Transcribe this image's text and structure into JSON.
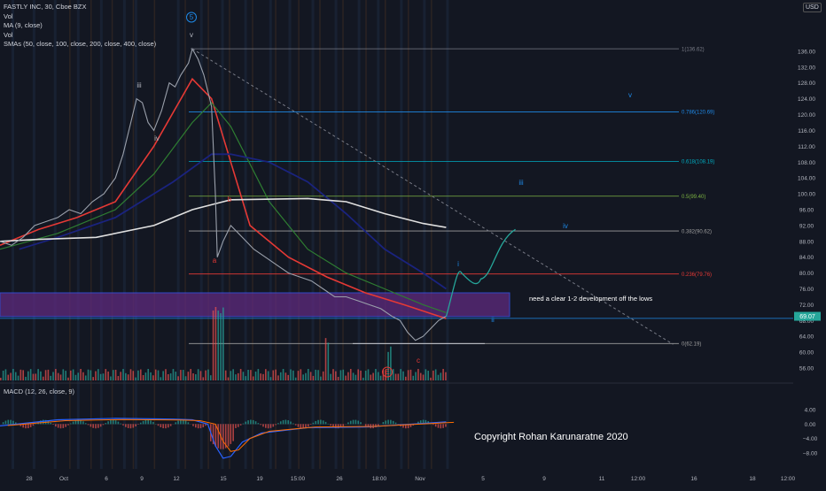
{
  "legend": {
    "title": "FASTLY INC, 30, Cboe BZX",
    "lines": [
      "Vol",
      "MA (9, close)",
      "Vol",
      "SMAs (50, close, 100, close, 200, close, 400, close)"
    ]
  },
  "currency": "USD",
  "macd_label": "MACD (12, 26, close, 9)",
  "copyright": "Copyright Rohan Karunaratne 2020",
  "note": "need a clear 1-2 development off the lows",
  "price_badge": "69.07",
  "colors": {
    "background": "#131722",
    "price": "#9aa0ab",
    "ma_red": "#e53935",
    "ma_green": "#2e7d32",
    "ma_blue": "#1a237e",
    "ma_white": "#e0e0e0",
    "zone": "#5e2a7e",
    "wave_projection": "#26a69a",
    "vol_up": "#26a69a",
    "vol_down": "#ef5350"
  },
  "chart_data": {
    "type": "line",
    "title": "FASTLY INC, 30, Cboe BZX",
    "y_axis": {
      "ticks": [
        136.0,
        132.0,
        128.0,
        124.0,
        120.0,
        116.0,
        112.0,
        108.0,
        104.0,
        100.0,
        96.0,
        92.0,
        88.0,
        84.0,
        80.0,
        76.0,
        72.0,
        68.0,
        64.0,
        60.0,
        56.0
      ],
      "ylim": [
        54,
        140
      ]
    },
    "macd_axis": {
      "ticks": [
        "4.00",
        "0.00",
        "−4.00",
        "−8.00"
      ],
      "ylim": [
        -10,
        6
      ]
    },
    "x_ticks": [
      "28",
      "Oct",
      "6",
      "9",
      "12",
      "15",
      "19",
      "15:00",
      "26",
      "18:00",
      "Nov",
      "5",
      "9",
      "11",
      "12:00",
      "16",
      "18",
      "12:00"
    ],
    "fib_levels": [
      {
        "label": "1(136.62)",
        "value": 136.62
      },
      {
        "label": "0.786(120.69)",
        "value": 120.69
      },
      {
        "label": "0.618(108.19)",
        "value": 108.19
      },
      {
        "label": "0.5(99.40)",
        "value": 99.4
      },
      {
        "label": "0.382(90.62)",
        "value": 90.62
      },
      {
        "label": "0.236(79.76)",
        "value": 79.76
      },
      {
        "label": "0(62.19)",
        "value": 62.19
      }
    ],
    "wave_labels": [
      "5",
      "v",
      "iii",
      "iv",
      "a",
      "b",
      "c",
      "E",
      "i",
      "ii",
      "iii",
      "iv",
      "v"
    ],
    "price_series": {
      "name": "FSLY",
      "points": [
        [
          0,
          88
        ],
        [
          6,
          87
        ],
        [
          12,
          89
        ],
        [
          18,
          92
        ],
        [
          24,
          93
        ],
        [
          30,
          94
        ],
        [
          36,
          96
        ],
        [
          42,
          95
        ],
        [
          48,
          98
        ],
        [
          54,
          100
        ],
        [
          60,
          104
        ],
        [
          64,
          110
        ],
        [
          68,
          118
        ],
        [
          71,
          124
        ],
        [
          74,
          123
        ],
        [
          77,
          118
        ],
        [
          80,
          116
        ],
        [
          84,
          121
        ],
        [
          88,
          128
        ],
        [
          91,
          127
        ],
        [
          94,
          130
        ],
        [
          98,
          133
        ],
        [
          100,
          136.6
        ],
        [
          103,
          134
        ],
        [
          106,
          130
        ],
        [
          108,
          126
        ],
        [
          110,
          122
        ],
        [
          112,
          100
        ],
        [
          113,
          84
        ],
        [
          116,
          88
        ],
        [
          120,
          92
        ],
        [
          126,
          89
        ],
        [
          132,
          86
        ],
        [
          138,
          84
        ],
        [
          144,
          82
        ],
        [
          150,
          80
        ],
        [
          156,
          79
        ],
        [
          162,
          78
        ],
        [
          168,
          76
        ],
        [
          174,
          74
        ],
        [
          180,
          74
        ],
        [
          186,
          73
        ],
        [
          192,
          72
        ],
        [
          198,
          71
        ],
        [
          204,
          69
        ],
        [
          208,
          68
        ],
        [
          212,
          65
        ],
        [
          216,
          63
        ],
        [
          220,
          64
        ],
        [
          224,
          66
        ],
        [
          228,
          68
        ],
        [
          232,
          69.07
        ]
      ]
    },
    "series": [
      {
        "name": "MA 9",
        "values": [
          [
            0,
            87
          ],
          [
            20,
            91
          ],
          [
            40,
            94
          ],
          [
            60,
            98
          ],
          [
            80,
            112
          ],
          [
            100,
            129
          ],
          [
            110,
            124
          ],
          [
            120,
            108
          ],
          [
            130,
            92
          ],
          [
            150,
            84
          ],
          [
            170,
            79
          ],
          [
            190,
            75
          ],
          [
            210,
            72
          ],
          [
            232,
            68.5
          ]
        ]
      },
      {
        "name": "SMA 50",
        "values": [
          [
            0,
            86
          ],
          [
            30,
            90
          ],
          [
            60,
            96
          ],
          [
            80,
            105
          ],
          [
            100,
            118
          ],
          [
            110,
            123
          ],
          [
            120,
            117
          ],
          [
            140,
            98
          ],
          [
            160,
            86
          ],
          [
            180,
            80
          ],
          [
            200,
            76
          ],
          [
            220,
            72
          ],
          [
            232,
            70
          ]
        ]
      },
      {
        "name": "SMA 100",
        "values": [
          [
            10,
            86
          ],
          [
            30,
            89
          ],
          [
            60,
            94
          ],
          [
            90,
            103
          ],
          [
            110,
            110
          ],
          [
            120,
            110
          ],
          [
            140,
            108
          ],
          [
            160,
            103
          ],
          [
            180,
            95
          ],
          [
            200,
            86
          ],
          [
            220,
            80
          ],
          [
            232,
            76
          ]
        ]
      },
      {
        "name": "SMA 200",
        "values": [
          [
            0,
            88
          ],
          [
            20,
            88.5
          ],
          [
            50,
            89
          ],
          [
            80,
            92
          ],
          [
            100,
            96
          ],
          [
            120,
            98.5
          ],
          [
            160,
            98.8
          ],
          [
            180,
            98
          ],
          [
            200,
            95
          ],
          [
            220,
            92.5
          ],
          [
            232,
            91.5
          ]
        ]
      }
    ],
    "projection": [
      [
        232,
        69
      ],
      [
        240,
        80
      ],
      [
        250,
        78.5
      ],
      [
        258,
        79
      ],
      [
        268,
        91
      ]
    ],
    "trendline": [
      [
        100,
        136.6
      ],
      [
        350,
        62
      ]
    ],
    "zone": {
      "top": 75,
      "bottom": 69
    }
  }
}
